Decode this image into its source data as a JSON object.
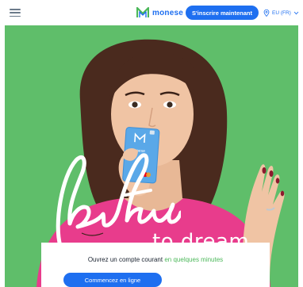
{
  "header": {
    "brand_name": "monese",
    "signup_label": "S'inscrire maintenant",
    "locale_label": "EU (FR)"
  },
  "hero": {
    "tagline_script": "be free",
    "tagline_text": "to dream",
    "card_text": "Monese"
  },
  "signup_box": {
    "headline_prefix": "Ouvrez un compte courant",
    "headline_accent": "en quelques minutes",
    "cta_label": "Commencez en ligne"
  },
  "colors": {
    "brand_blue": "#1e6ff0",
    "hero_green": "#5fbe6a",
    "accent_green": "#4cb85a",
    "shirt_pink": "#e83c8c"
  },
  "icons": [
    "menu-icon",
    "monese-logo-icon",
    "location-pin-icon",
    "chevron-down-icon"
  ]
}
